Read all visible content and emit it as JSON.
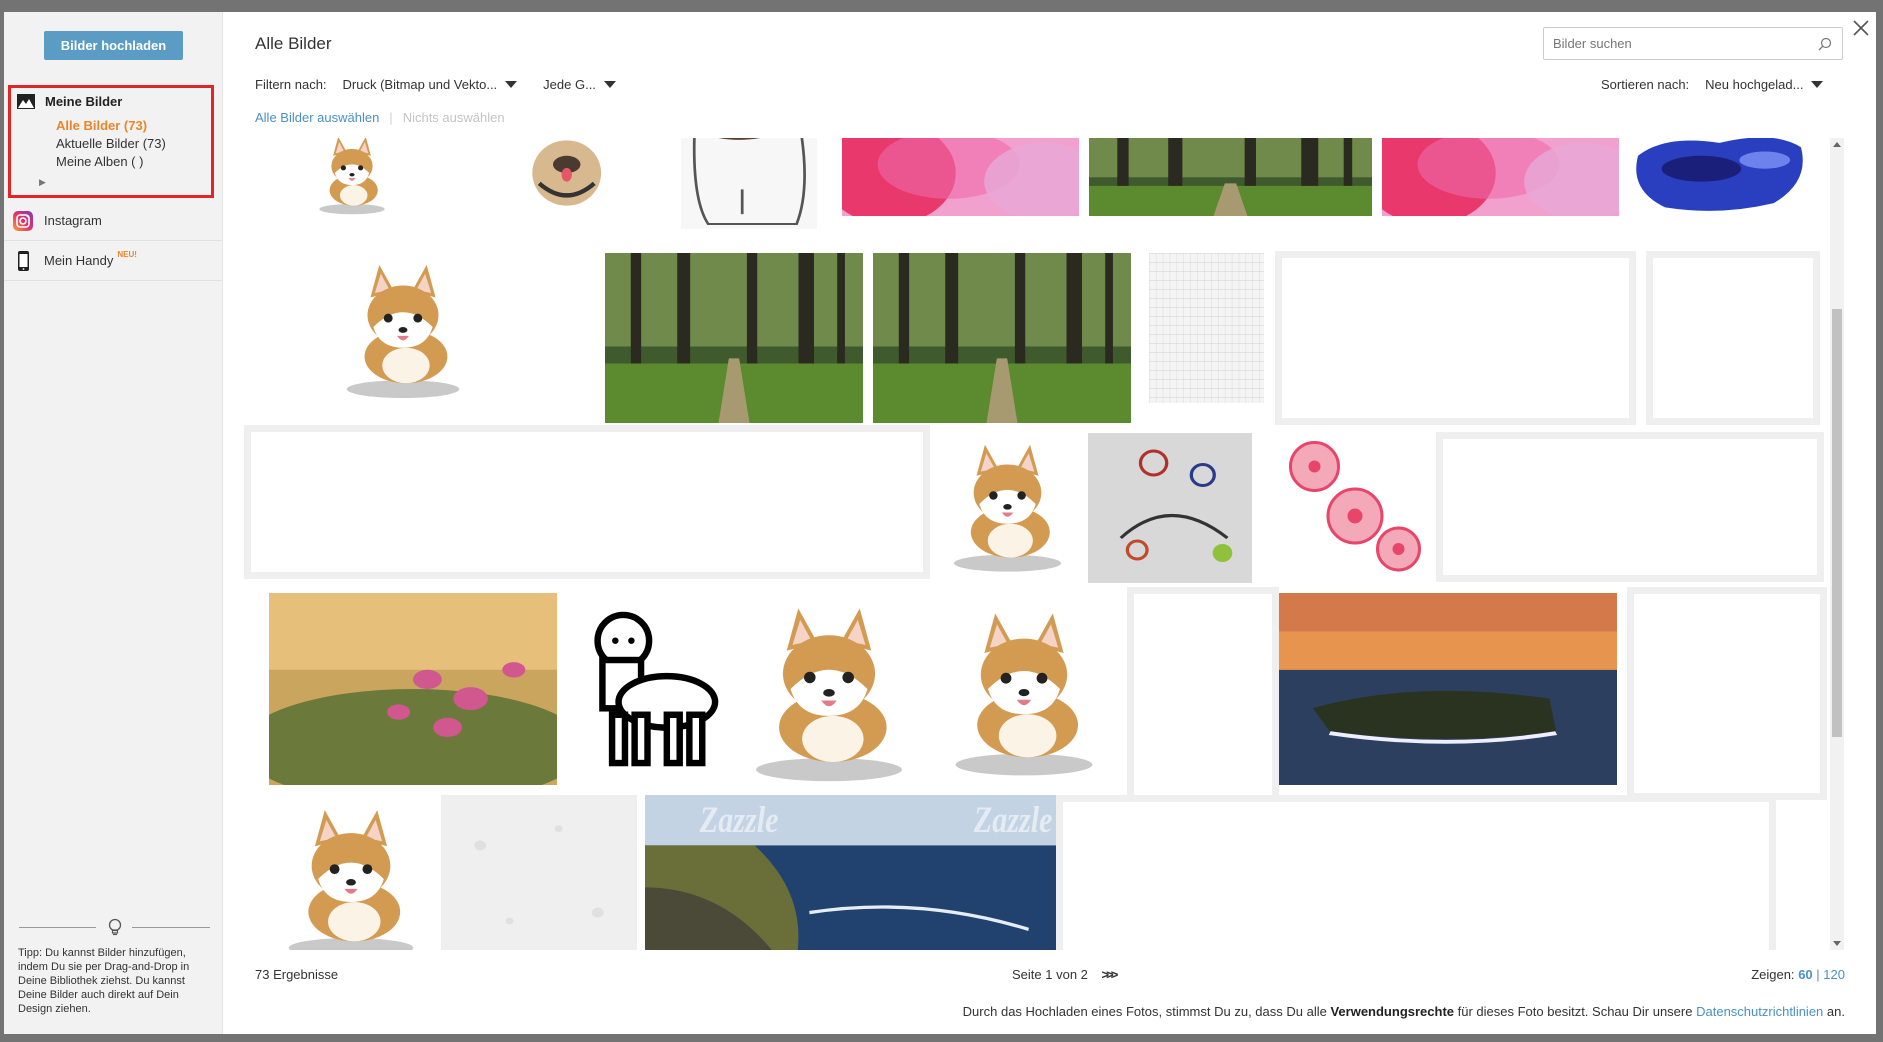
{
  "sidebar": {
    "upload_label": "Bilder hochladen",
    "my_images": {
      "title": "Meine Bilder",
      "all": "Alle Bilder (73)",
      "recent": "Aktuelle Bilder (73)",
      "albums": "Meine Alben (  )"
    },
    "sources": [
      {
        "label": "Instagram",
        "icon": "instagram-icon"
      },
      {
        "label": "Mein Handy",
        "icon": "phone-icon",
        "badge": "NEU!"
      }
    ],
    "tip": "Tipp: Du kannst Bilder hinzufügen, indem Du sie per Drag-and-Drop in Deine Bibliothek ziehst. Du kannst Deine Bilder auch direkt auf Dein Design ziehen."
  },
  "main": {
    "title": "Alle Bilder",
    "search_placeholder": "Bilder suchen",
    "filter": {
      "label": "Filtern nach:",
      "type_value": "Druck (Bitmap und Vekto...",
      "size_value": "Jede G..."
    },
    "sort": {
      "label": "Sortieren nach:",
      "value": "Neu hochgelad..."
    },
    "select_all": "Alle Bilder auswählen",
    "select_none": "Nichts auswählen",
    "divider": "|"
  },
  "footer": {
    "results": "73 Ergebnisse",
    "page": "Seite 1 von 2",
    "next": "»",
    "show_label": "Zeigen:",
    "show_60": "60",
    "show_sep": "|",
    "show_120": "120",
    "legal_before": "Durch das Hochladen eines Fotos, stimmst Du zu, dass Du alle",
    "legal_bold": "Verwendungsrechte",
    "legal_mid": "für dieses Foto besitzt. Schau Dir unsere",
    "legal_link": "Datenschutzrichtlinien",
    "legal_after": "an."
  },
  "images": [
    {
      "name": "corgi-back-image",
      "kind": "corgi"
    },
    {
      "name": "pug-image",
      "kind": "pug"
    },
    {
      "name": "pug-sketch-image",
      "kind": "sketch"
    },
    {
      "name": "pink-watercolor-image",
      "kind": "watercolor-pink"
    },
    {
      "name": "forest-path-image",
      "kind": "forest"
    },
    {
      "name": "pink-watercolor-image-2",
      "kind": "watercolor-pink"
    },
    {
      "name": "blue-watercolor-image",
      "kind": "watercolor-blue"
    },
    {
      "name": "corgi-sleeping-image",
      "kind": "corgi"
    },
    {
      "name": "forest-image",
      "kind": "forest"
    },
    {
      "name": "forest-path-image-2",
      "kind": "forest"
    },
    {
      "name": "grid-paper-image",
      "kind": "grid"
    },
    {
      "name": "blank-image",
      "kind": "blank"
    },
    {
      "name": "blank-image",
      "kind": "blank"
    },
    {
      "name": "blank-image",
      "kind": "blank"
    },
    {
      "name": "corgi-sitting-image",
      "kind": "corgi"
    },
    {
      "name": "quilling-image",
      "kind": "quilling"
    },
    {
      "name": "flowers-drawing-image",
      "kind": "flowers"
    },
    {
      "name": "blank-image",
      "kind": "blank"
    },
    {
      "name": "flower-photo-image",
      "kind": "flower-photo"
    },
    {
      "name": "llama-image",
      "kind": "llama"
    },
    {
      "name": "corgi-standing-image",
      "kind": "corgi"
    },
    {
      "name": "corgi-sitting-image-2",
      "kind": "corgi"
    },
    {
      "name": "blank-image",
      "kind": "blank"
    },
    {
      "name": "coast-sunset-image",
      "kind": "sunset"
    },
    {
      "name": "blank-image",
      "kind": "blank"
    },
    {
      "name": "corgi-sitting-image-3",
      "kind": "corgi"
    },
    {
      "name": "paper-texture-image",
      "kind": "texture"
    },
    {
      "name": "coast-image",
      "kind": "coast",
      "watermark": "Zazzle"
    },
    {
      "name": "blank-image",
      "kind": "blank"
    }
  ],
  "colors": {
    "accent": "#5b9cc5",
    "active": "#e8862b",
    "link": "#4a90c5",
    "highlight": "#e0262b"
  }
}
